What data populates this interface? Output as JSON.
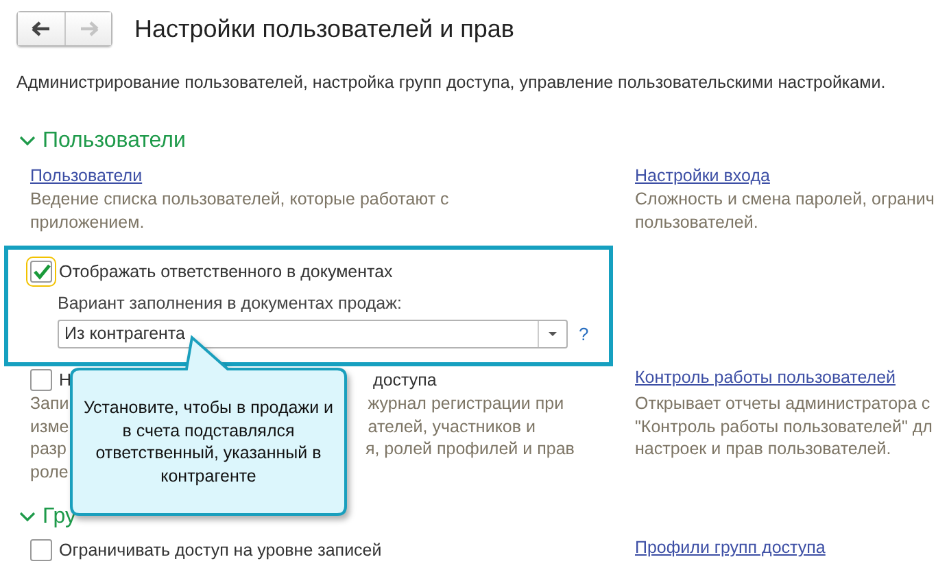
{
  "window": {
    "title": "Настройки пользователей и прав"
  },
  "nav_buttons": [
    {
      "kind": "back",
      "disabled": false
    },
    {
      "kind": "forward",
      "disabled": true
    }
  ],
  "description": "Администрирование пользователей, настройка групп доступа, управление пользовательскими настройками.",
  "sections": [
    {
      "title": "Пользователи",
      "expanded": true,
      "rows": [
        {
          "left": {
            "kind": "link",
            "text": "Пользователи"
          },
          "right": {
            "kind": "link",
            "text": "Настройки входа"
          }
        },
        {
          "left": {
            "kind": "note",
            "lines": [
              [
                "Ведение списка пользователей, которые работают с"
              ],
              [
                "приложением."
              ]
            ]
          },
          "right": {
            "kind": "note",
            "lines": [
              [
                "Сложность и смена паролей, огранич"
              ],
              [
                "пользователей."
              ]
            ]
          }
        },
        {
          "left": {
            "kind": "highlight",
            "checkbox": {
              "label": "Отображать ответственного в документах",
              "checked": true
            },
            "field_label": "Вариант заполнения в документах продаж:",
            "field_value": "Из контрагента",
            "help": "?"
          }
        },
        {
          "left": {
            "kind": "checkbox",
            "checked": false,
            "parts": [
              "Н",
              "доступа"
            ]
          },
          "right": {
            "kind": "link",
            "text": "Контроль работы пользователей"
          }
        },
        {
          "left": {
            "kind": "note",
            "lines": [
              [
                "Запи",
                "журнал регистрации при"
              ],
              [
                "изме",
                "ателей, участников и"
              ],
              [
                "разр",
                "я, ролей профилей и прав"
              ],
              [
                "роле"
              ]
            ]
          },
          "right": {
            "kind": "note",
            "lines": [
              [
                "Открывает отчеты администратора с"
              ],
              [
                "\"Контроль работы пользователей\" дл"
              ],
              [
                "настроек и прав пользователей."
              ]
            ]
          }
        }
      ]
    },
    {
      "title": "Гру",
      "expanded": true,
      "rows": [
        {
          "left": {
            "kind": "checkbox",
            "checked": false,
            "parts": [
              "Ограничивать доступ на уровне записей"
            ]
          },
          "right": {
            "kind": "link",
            "text": "Профили групп доступа"
          }
        }
      ]
    }
  ],
  "callout": {
    "text": "Установите, чтобы в продажи и в счета подставлялся ответственный, указанный в контрагенте"
  }
}
